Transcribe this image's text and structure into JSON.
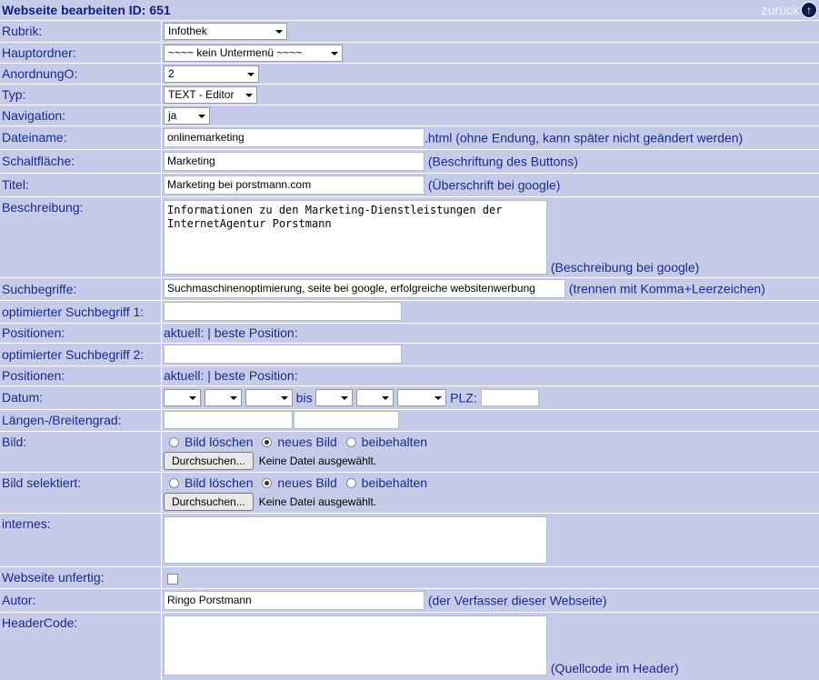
{
  "header": {
    "title": "Webseite bearbeiten ID: 651",
    "back_label": "zurück"
  },
  "fields": {
    "rubrik": {
      "label": "Rubrik:",
      "value": "Infothek"
    },
    "hauptordner": {
      "label": "Hauptordner:",
      "value": "~~~~ kein Untermenü ~~~~"
    },
    "anordnung": {
      "label": "AnordnungO:",
      "value": "2"
    },
    "typ": {
      "label": "Typ:",
      "value": "TEXT - Editor"
    },
    "navigation": {
      "label": "Navigation:",
      "value": "ja"
    },
    "dateiname": {
      "label": "Dateiname:",
      "value": "onlinemarketing",
      "hint": ".html (ohne Endung, kann später nicht geändert werden)"
    },
    "schaltflaeche": {
      "label": "Schaltfläche:",
      "value": "Marketing",
      "hint": "(Beschriftung des Buttons)"
    },
    "titel": {
      "label": "Titel:",
      "value": "Marketing bei porstmann.com",
      "hint": "(Überschrift bei google)"
    },
    "beschreibung": {
      "label": "Beschreibung:",
      "value": "Informationen zu den Marketing-Dienstleistungen der InternetAgentur Porstmann",
      "hint": "(Beschreibung bei google)"
    },
    "suchbegriffe": {
      "label": "Suchbegriffe:",
      "value": "Suchmaschinenoptimierung, seite bei google, erfolgreiche websitenwerbung",
      "hint": "(trennen mit Komma+Leerzeichen)"
    },
    "opt1": {
      "label": "optimierter Suchbegriff 1:",
      "value": ""
    },
    "pos1": {
      "label": "Positionen:",
      "value": "aktuell: | beste Position:"
    },
    "opt2": {
      "label": "optimierter Suchbegriff 2:",
      "value": ""
    },
    "pos2": {
      "label": "Positionen:",
      "value": "aktuell: | beste Position:"
    },
    "datum": {
      "label": "Datum:",
      "bis": "bis",
      "plz": "PLZ:"
    },
    "laengen": {
      "label": "Längen-/Breitengrad:"
    },
    "bild": {
      "label": "Bild:"
    },
    "bild_sel": {
      "label": "Bild selektiert:"
    },
    "internes": {
      "label": "internes:",
      "value": ""
    },
    "unfertig": {
      "label": "Webseite unfertig:"
    },
    "autor": {
      "label": "Autor:",
      "value": "Ringo Porstmann",
      "hint": "(der Verfasser dieser Webseite)"
    },
    "headercode": {
      "label": "HeaderCode:",
      "value": "",
      "hint": "(Quellcode im Header)"
    }
  },
  "image_options": {
    "delete": "Bild löschen",
    "new": "neues Bild",
    "keep": "beibehalten",
    "browse": "Durchsuchen...",
    "no_file": "Keine Datei ausgewählt."
  },
  "icons": {
    "back": "arrow-up-circle-icon"
  },
  "colors": {
    "background": "#c6cbe9",
    "text": "#1a2a8a"
  }
}
